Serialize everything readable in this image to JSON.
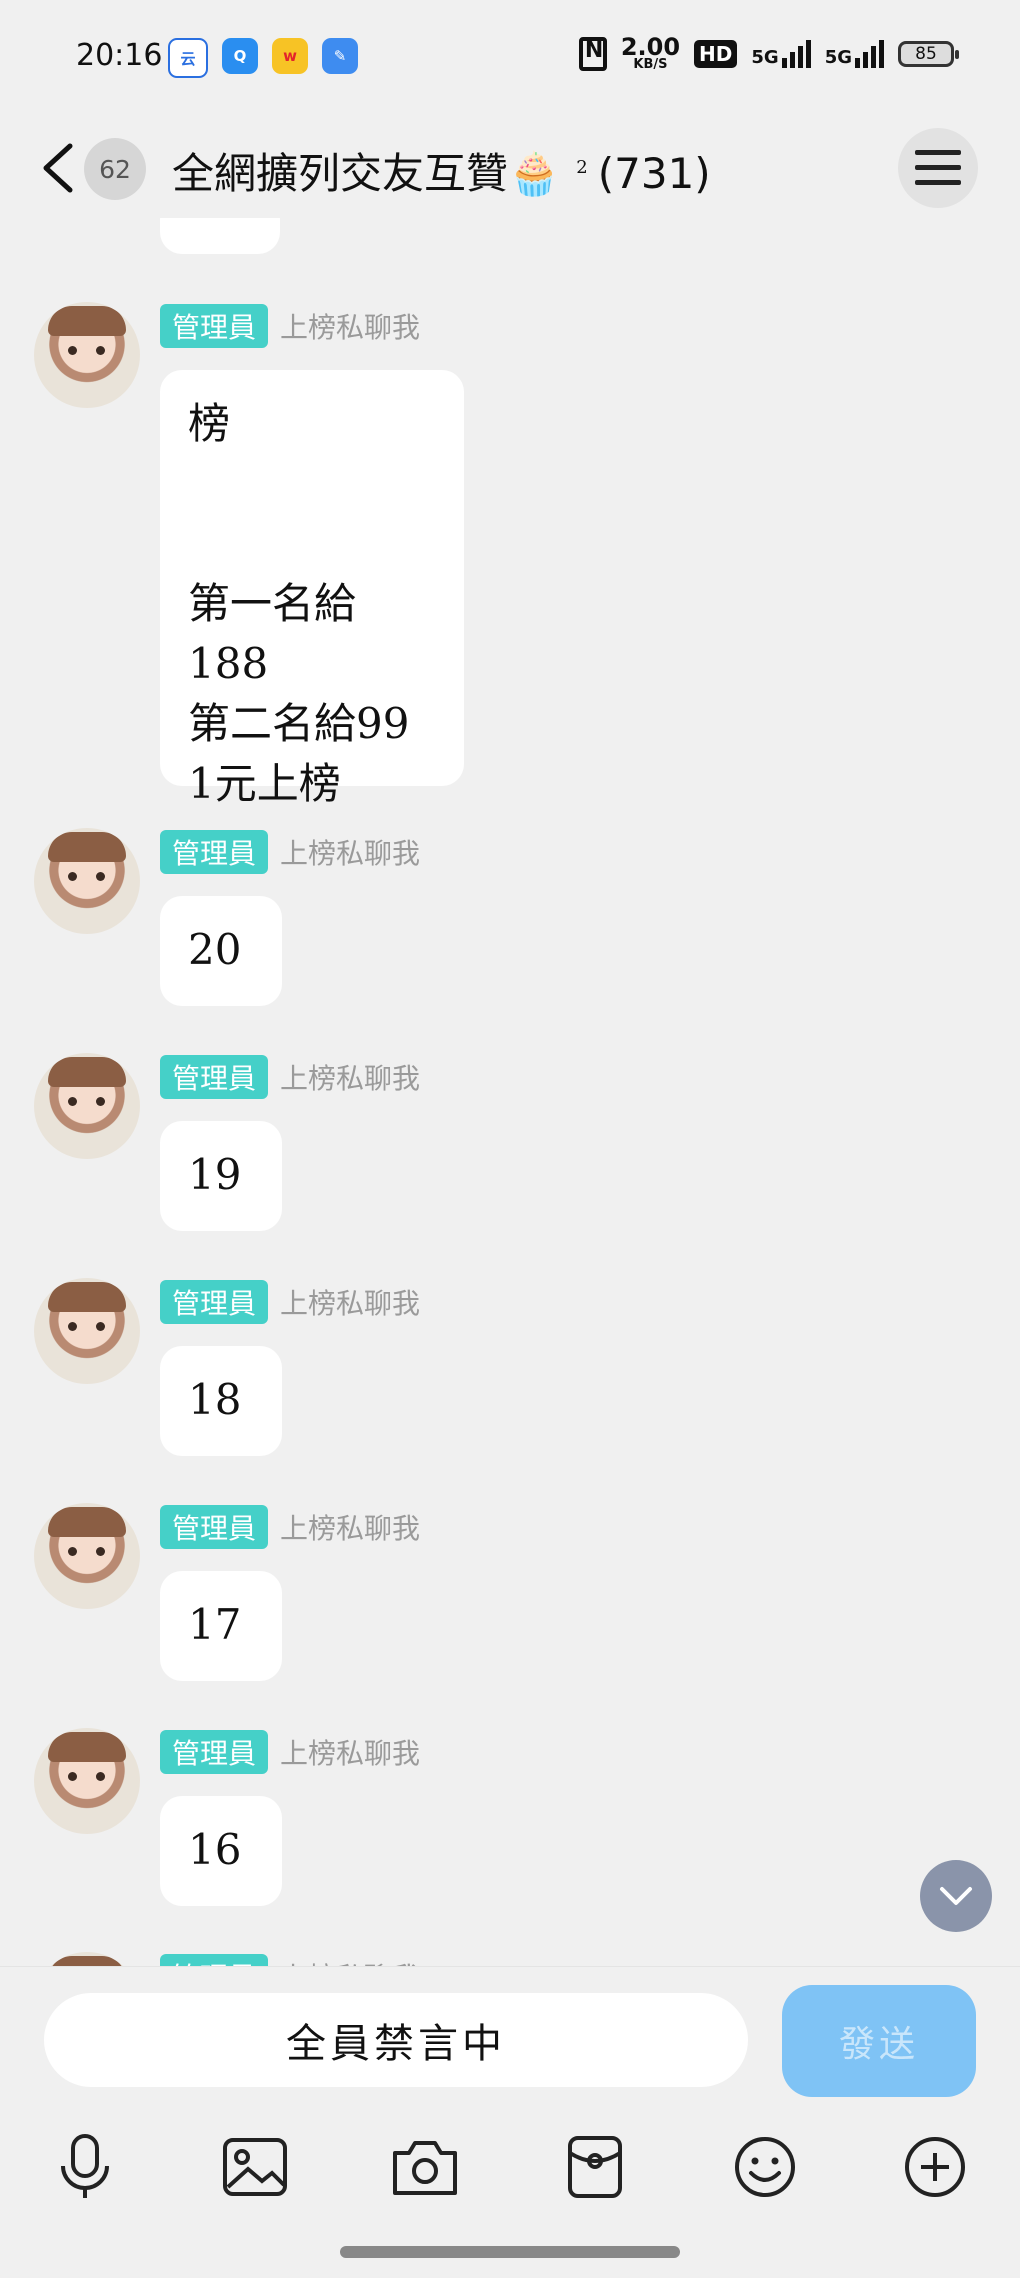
{
  "status_bar": {
    "time": "20:16",
    "net_speed": "2.00",
    "net_unit": "KB/S",
    "hd": "HD",
    "signal1": "5G",
    "signal2": "5G",
    "battery": "85"
  },
  "header": {
    "unread_count": "62",
    "title": "全網擴列交友互贊🧁",
    "title_sup": "2",
    "member_count": "(731)"
  },
  "messages": [
    {
      "badge": "管理員",
      "nick": "上榜私聊我",
      "text": "榜\n\n\n第一名給188\n第二名給99\n1元上榜"
    },
    {
      "badge": "管理員",
      "nick": "上榜私聊我",
      "text": "20"
    },
    {
      "badge": "管理員",
      "nick": "上榜私聊我",
      "text": "19"
    },
    {
      "badge": "管理員",
      "nick": "上榜私聊我",
      "text": "18"
    },
    {
      "badge": "管理員",
      "nick": "上榜私聊我",
      "text": "17"
    },
    {
      "badge": "管理員",
      "nick": "上榜私聊我",
      "text": "16"
    },
    {
      "badge": "管理員",
      "nick": "上榜私聊我",
      "text": ""
    }
  ],
  "input": {
    "placeholder": "全員禁言中",
    "send_label": "發送"
  },
  "toolbar": {
    "icons": [
      "microphone-icon",
      "image-icon",
      "camera-icon",
      "red-packet-icon",
      "emoji-icon",
      "plus-icon"
    ]
  },
  "colors": {
    "admin_badge": "#45d0c8",
    "send_button": "#7fc3f5",
    "background": "#f0f0f0"
  }
}
